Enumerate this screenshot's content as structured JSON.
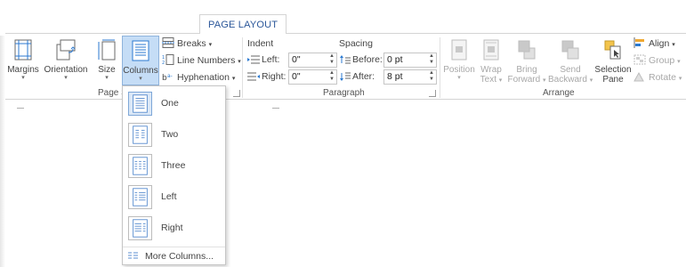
{
  "tabs": {
    "active": "PAGE LAYOUT"
  },
  "page_setup": {
    "label": "Page S",
    "margins": "Margins",
    "orientation": "Orientation",
    "size": "Size",
    "columns": "Columns",
    "breaks": "Breaks",
    "line_numbers": "Line Numbers",
    "hyphenation": "Hyphenation",
    "dropdown_arrow": "▾",
    "small_arrow": "▾"
  },
  "paragraph": {
    "label": "Paragraph",
    "indent_heading": "Indent",
    "spacing_heading": "Spacing",
    "left_label": "Left:",
    "right_label": "Right:",
    "before_label": "Before:",
    "after_label": "After:",
    "left_value": "0\"",
    "right_value": "0\"",
    "before_value": "0 pt",
    "after_value": "8 pt"
  },
  "arrange": {
    "label": "Arrange",
    "position": "Position",
    "wrap_text_1": "Wrap",
    "wrap_text_2": "Text",
    "bring_forward_1": "Bring",
    "bring_forward_2": "Forward",
    "send_backward_1": "Send",
    "send_backward_2": "Backward",
    "selection_pane_1": "Selection",
    "selection_pane_2": "Pane",
    "align": "Align",
    "group": "Group",
    "rotate": "Rotate"
  },
  "columns_menu": {
    "items": [
      {
        "label": "One",
        "icon": "one-column-icon"
      },
      {
        "label": "Two",
        "icon": "two-columns-icon"
      },
      {
        "label": "Three",
        "icon": "three-columns-icon"
      },
      {
        "label": "Left",
        "icon": "left-column-icon"
      },
      {
        "label": "Right",
        "icon": "right-column-icon"
      }
    ],
    "more": "More Columns..."
  },
  "colors": {
    "accent": "#2b579a",
    "active_bg": "#c5ddf6",
    "active_border": "#8fb3dc"
  }
}
